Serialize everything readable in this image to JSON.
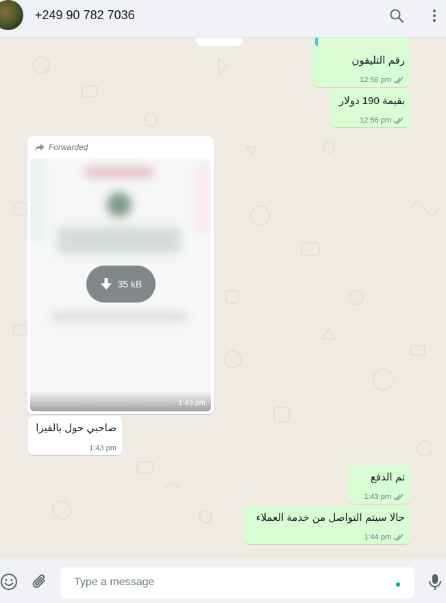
{
  "header": {
    "contact_name": "+249 90 782 7036",
    "icons": [
      "avatar",
      "search-icon",
      "menu-icon"
    ]
  },
  "messages": [
    {
      "direction": "out",
      "text": "رقم التليفون",
      "time": "12:56 pm",
      "status": "read"
    },
    {
      "direction": "out",
      "text": "بقيمة 190 دولار",
      "time": "12:56 pm",
      "status": "read"
    },
    {
      "direction": "in",
      "forwarded_label": "Forwarded",
      "type": "image",
      "download_size": "35 kB",
      "time": "1:43 pm"
    },
    {
      "direction": "in",
      "text": "صاحبي حول بالفيزا",
      "time": "1:43 pm"
    },
    {
      "direction": "out",
      "text": "تم الدفع",
      "time": "1:43 pm",
      "status": "read"
    },
    {
      "direction": "out",
      "text": "حالا سيتم التواصل من خدمة العملاء",
      "time": "1:44 pm",
      "status": "read"
    }
  ],
  "composer": {
    "placeholder": "Type a message",
    "icons": [
      "emoji-icon",
      "attach-icon",
      "mic-icon"
    ]
  },
  "colors": {
    "outgoing_bubble": "#d9fdd3",
    "incoming_bubble": "#ffffff",
    "chat_background": "#efeae2",
    "read_ticks": "#8696a0",
    "accent": "#00a884"
  }
}
